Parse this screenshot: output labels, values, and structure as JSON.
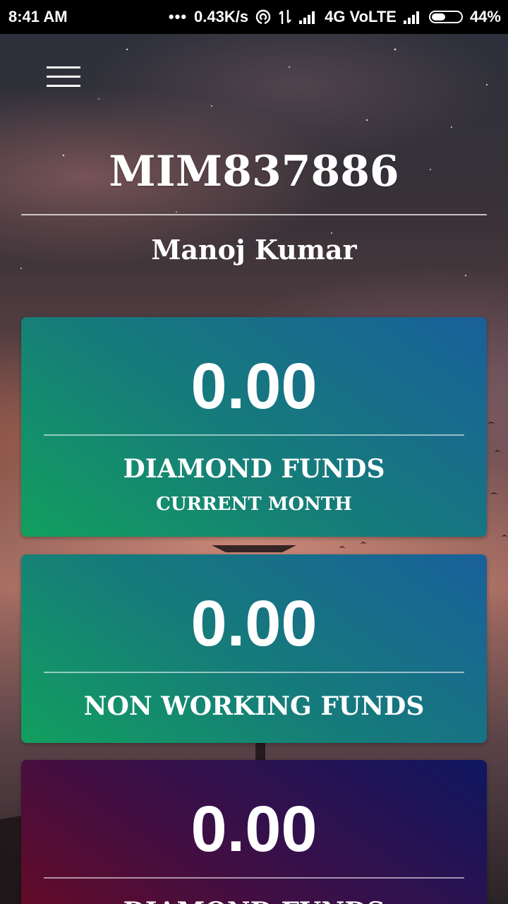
{
  "status_bar": {
    "time": "8:41 AM",
    "dots": "•••",
    "net_speed": "0.43K/s",
    "network_label": "4G VoLTE",
    "battery_percent": "44%",
    "icons": [
      "hotspot-icon",
      "data-arrows-icon",
      "signal-icon",
      "signal-icon",
      "battery-icon"
    ]
  },
  "header": {
    "menu_icon": "hamburger-menu-icon",
    "member_id": "MIM837886",
    "member_name": "Manoj Kumar"
  },
  "cards": [
    {
      "amount": "0.00",
      "title": "DIAMOND FUNDS",
      "subtitle": "CURRENT MONTH",
      "color": "#167c7a"
    },
    {
      "amount": "0.00",
      "title": "NON WORKING FUNDS",
      "subtitle": "",
      "color": "#167c7a"
    },
    {
      "amount": "0.00",
      "title": "DIAMOND FUNDS",
      "subtitle": "",
      "color": "#3f0f45"
    }
  ]
}
